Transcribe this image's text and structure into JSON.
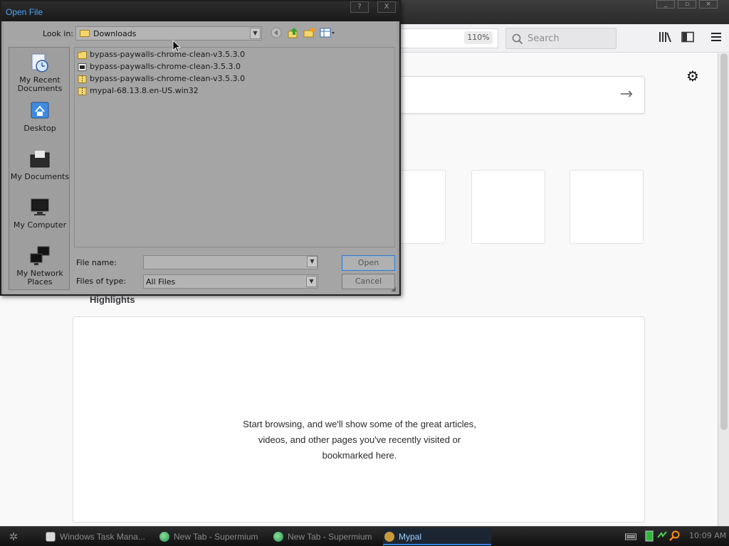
{
  "browser": {
    "zoom": "110%",
    "search_placeholder": "Search",
    "highlights_title": "Highlights",
    "highlights_message_line1": "Start browsing, and we'll show some of the great articles,",
    "highlights_message_line2": "videos, and other pages you've recently visited or",
    "highlights_message_line3": "bookmarked here."
  },
  "dialog": {
    "title": "Open File",
    "help_btn": "?",
    "close_btn": "X",
    "lookin_label": "Look in:",
    "lookin_value": "Downloads",
    "places": [
      {
        "label": "My Recent Documents"
      },
      {
        "label": "Desktop"
      },
      {
        "label": "My Documents"
      },
      {
        "label": "My Computer"
      },
      {
        "label": "My Network Places"
      }
    ],
    "files": [
      {
        "name": "bypass-paywalls-chrome-clean-v3.5.3.0",
        "icon": "folder-icon"
      },
      {
        "name": "bypass-paywalls-chrome-clean-3.5.3.0",
        "icon": "crx-file-icon"
      },
      {
        "name": "bypass-paywalls-chrome-clean-v3.5.3.0",
        "icon": "zip-file-icon"
      },
      {
        "name": "mypal-68.13.8.en-US.win32",
        "icon": "zip-file-icon"
      }
    ],
    "filename_label": "File name:",
    "filename_value": "",
    "filetype_label": "Files of type:",
    "filetype_value": "All Files",
    "open_label": "Open",
    "cancel_label": "Cancel"
  },
  "taskbar": {
    "tasks": [
      {
        "label": "Windows Task Mana..."
      },
      {
        "label": "New Tab - Supermium"
      },
      {
        "label": "New Tab - Supermium"
      },
      {
        "label": "Mypal"
      }
    ],
    "clock": "10:09 AM"
  },
  "colors": {
    "accent": "#4da3ff",
    "taskbar_active": "#3b82d8",
    "dialog_bg": "#a5a5a5"
  }
}
